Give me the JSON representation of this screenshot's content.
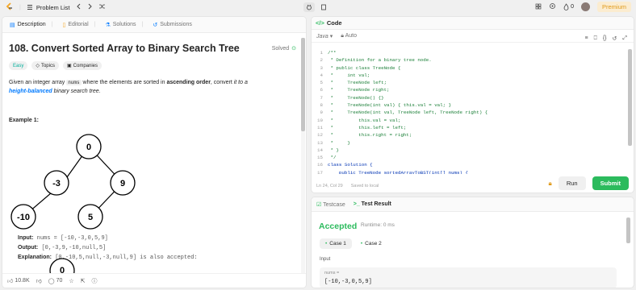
{
  "topbar": {
    "problem_list": "Problem List",
    "streak": "0",
    "premium": "Premium"
  },
  "desc_tabs": [
    "Description",
    "Editorial",
    "Solutions",
    "Submissions"
  ],
  "problem": {
    "title": "108. Convert Sorted Array to Binary Search Tree",
    "solved": "Solved",
    "difficulty": "Easy",
    "topics": "Topics",
    "companies": "Companies",
    "text_1": "Given an integer array ",
    "text_code": "nums",
    "text_2": " where the elements are sorted in ",
    "text_bold": "ascending order",
    "text_3": ", convert ",
    "text_it": "it to a",
    "text_link": "height-balanced",
    "text_4": " binary search tree.",
    "example_label": "Example 1:",
    "tree_nodes": [
      "0",
      "-3",
      "9",
      "-10",
      "5"
    ],
    "input_label": "Input:",
    "input_val": "nums = [-10,-3,0,5,9]",
    "output_label": "Output:",
    "output_val": "[0,-3,9,-10,null,5]",
    "expl_label": "Explanation:",
    "expl_val": "[0,-10,5,null,-3,null,9] is also accepted:",
    "tree2_root": "0"
  },
  "footer": {
    "likes": "10.8K",
    "comments": "70"
  },
  "code": {
    "tab": "Code",
    "lang": "Java",
    "auto": "Auto",
    "lines": [
      {
        "n": "1",
        "t": "/**",
        "kw": false
      },
      {
        "n": "2",
        "t": " * Definition for a binary tree node.",
        "kw": false
      },
      {
        "n": "3",
        "t": " * public class TreeNode {",
        "kw": false
      },
      {
        "n": "4",
        "t": " *     int val;",
        "kw": false
      },
      {
        "n": "5",
        "t": " *     TreeNode left;",
        "kw": false
      },
      {
        "n": "6",
        "t": " *     TreeNode right;",
        "kw": false
      },
      {
        "n": "7",
        "t": " *     TreeNode() {}",
        "kw": false
      },
      {
        "n": "8",
        "t": " *     TreeNode(int val) { this.val = val; }",
        "kw": false
      },
      {
        "n": "9",
        "t": " *     TreeNode(int val, TreeNode left, TreeNode right) {",
        "kw": false
      },
      {
        "n": "10",
        "t": " *         this.val = val;",
        "kw": false
      },
      {
        "n": "11",
        "t": " *         this.left = left;",
        "kw": false
      },
      {
        "n": "12",
        "t": " *         this.right = right;",
        "kw": false
      },
      {
        "n": "13",
        "t": " *     }",
        "kw": false
      },
      {
        "n": "14",
        "t": " * }",
        "kw": false
      },
      {
        "n": "15",
        "t": " */",
        "kw": false
      },
      {
        "n": "16",
        "t": "class Solution {",
        "kw": true
      },
      {
        "n": "17",
        "t": "    public TreeNode sortedArrayToBST(int[] nums) {",
        "kw": true
      }
    ],
    "cursor": "Ln 24, Col 29",
    "saved": "Saved to local",
    "run": "Run",
    "submit": "Submit"
  },
  "test": {
    "tab_testcase": "Testcase",
    "tab_result": "Test Result",
    "status": "Accepted",
    "runtime": "Runtime: 0 ms",
    "cases": [
      "Case 1",
      "Case 2"
    ],
    "input_label": "Input",
    "param_name": "nums =",
    "param_value": "[-10,-3,0,5,9]"
  },
  "colors": {
    "accent_green": "#2cbb5d",
    "easy": "#00af9b",
    "link": "#007aff",
    "premium": "#e09a1a"
  }
}
